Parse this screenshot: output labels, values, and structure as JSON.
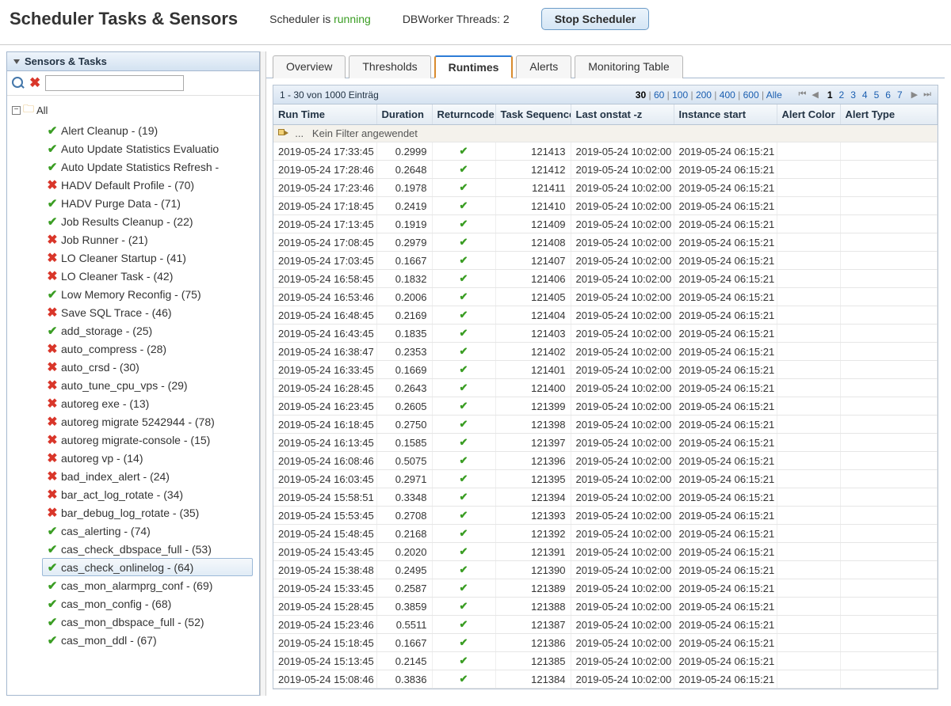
{
  "header": {
    "title": "Scheduler Tasks & Sensors",
    "scheduler_label": "Scheduler is ",
    "scheduler_status": "running",
    "dbworker": "DBWorker Threads: 2",
    "stop_button": "Stop Scheduler"
  },
  "sidebar": {
    "title": "Sensors & Tasks",
    "root_label": "All",
    "search_placeholder": "",
    "items": [
      {
        "status": "ok",
        "label": "Alert Cleanup - (19)"
      },
      {
        "status": "ok",
        "label": "Auto Update Statistics Evaluatio"
      },
      {
        "status": "ok",
        "label": "Auto Update Statistics Refresh -"
      },
      {
        "status": "err",
        "label": "HADV Default Profile - (70)"
      },
      {
        "status": "ok",
        "label": "HADV Purge Data - (71)"
      },
      {
        "status": "ok",
        "label": "Job Results Cleanup - (22)"
      },
      {
        "status": "err",
        "label": "Job Runner - (21)"
      },
      {
        "status": "err",
        "label": "LO Cleaner Startup - (41)"
      },
      {
        "status": "err",
        "label": "LO Cleaner Task - (42)"
      },
      {
        "status": "ok",
        "label": "Low Memory Reconfig - (75)"
      },
      {
        "status": "err",
        "label": "Save SQL Trace - (46)"
      },
      {
        "status": "ok",
        "label": "add_storage - (25)"
      },
      {
        "status": "err",
        "label": "auto_compress - (28)"
      },
      {
        "status": "err",
        "label": "auto_crsd - (30)"
      },
      {
        "status": "err",
        "label": "auto_tune_cpu_vps - (29)"
      },
      {
        "status": "err",
        "label": "autoreg exe - (13)"
      },
      {
        "status": "err",
        "label": "autoreg migrate 5242944 - (78)"
      },
      {
        "status": "err",
        "label": "autoreg migrate-console - (15)"
      },
      {
        "status": "err",
        "label": "autoreg vp - (14)"
      },
      {
        "status": "err",
        "label": "bad_index_alert - (24)"
      },
      {
        "status": "err",
        "label": "bar_act_log_rotate - (34)"
      },
      {
        "status": "err",
        "label": "bar_debug_log_rotate - (35)"
      },
      {
        "status": "ok",
        "label": "cas_alerting - (74)"
      },
      {
        "status": "ok",
        "label": "cas_check_dbspace_full - (53)"
      },
      {
        "status": "ok",
        "label": "cas_check_onlinelog - (64)",
        "selected": true
      },
      {
        "status": "ok",
        "label": "cas_mon_alarmprg_conf - (69)"
      },
      {
        "status": "ok",
        "label": "cas_mon_config - (68)"
      },
      {
        "status": "ok",
        "label": "cas_mon_dbspace_full - (52)"
      },
      {
        "status": "ok",
        "label": "cas_mon_ddl - (67)"
      }
    ]
  },
  "tabs": [
    {
      "label": "Overview"
    },
    {
      "label": "Thresholds"
    },
    {
      "label": "Runtimes",
      "active": true
    },
    {
      "label": "Alerts"
    },
    {
      "label": "Monitoring Table"
    }
  ],
  "grid": {
    "range": "1 - 30 von 1000 Einträg",
    "page_sizes": [
      "30",
      "60",
      "100",
      "200",
      "400",
      "600",
      "Alle"
    ],
    "current_page_size": "30",
    "pages": [
      "1",
      "2",
      "3",
      "4",
      "5",
      "6",
      "7"
    ],
    "current_page": "1",
    "filter_text": "Kein Filter angewendet",
    "filter_dots": "...",
    "columns": [
      "Run Time",
      "Duration",
      "Returncode",
      "Task Sequence",
      "Last onstat -z",
      "Instance start",
      "Alert Color",
      "Alert Type"
    ],
    "rows": [
      {
        "run": "2019-05-24 17:33:45",
        "dur": "0.2999",
        "seq": "121413",
        "onstat": "2019-05-24 10:02:00",
        "inst": "2019-05-24 06:15:21"
      },
      {
        "run": "2019-05-24 17:28:46",
        "dur": "0.2648",
        "seq": "121412",
        "onstat": "2019-05-24 10:02:00",
        "inst": "2019-05-24 06:15:21"
      },
      {
        "run": "2019-05-24 17:23:46",
        "dur": "0.1978",
        "seq": "121411",
        "onstat": "2019-05-24 10:02:00",
        "inst": "2019-05-24 06:15:21"
      },
      {
        "run": "2019-05-24 17:18:45",
        "dur": "0.2419",
        "seq": "121410",
        "onstat": "2019-05-24 10:02:00",
        "inst": "2019-05-24 06:15:21"
      },
      {
        "run": "2019-05-24 17:13:45",
        "dur": "0.1919",
        "seq": "121409",
        "onstat": "2019-05-24 10:02:00",
        "inst": "2019-05-24 06:15:21"
      },
      {
        "run": "2019-05-24 17:08:45",
        "dur": "0.2979",
        "seq": "121408",
        "onstat": "2019-05-24 10:02:00",
        "inst": "2019-05-24 06:15:21"
      },
      {
        "run": "2019-05-24 17:03:45",
        "dur": "0.1667",
        "seq": "121407",
        "onstat": "2019-05-24 10:02:00",
        "inst": "2019-05-24 06:15:21"
      },
      {
        "run": "2019-05-24 16:58:45",
        "dur": "0.1832",
        "seq": "121406",
        "onstat": "2019-05-24 10:02:00",
        "inst": "2019-05-24 06:15:21"
      },
      {
        "run": "2019-05-24 16:53:46",
        "dur": "0.2006",
        "seq": "121405",
        "onstat": "2019-05-24 10:02:00",
        "inst": "2019-05-24 06:15:21"
      },
      {
        "run": "2019-05-24 16:48:45",
        "dur": "0.2169",
        "seq": "121404",
        "onstat": "2019-05-24 10:02:00",
        "inst": "2019-05-24 06:15:21"
      },
      {
        "run": "2019-05-24 16:43:45",
        "dur": "0.1835",
        "seq": "121403",
        "onstat": "2019-05-24 10:02:00",
        "inst": "2019-05-24 06:15:21"
      },
      {
        "run": "2019-05-24 16:38:47",
        "dur": "0.2353",
        "seq": "121402",
        "onstat": "2019-05-24 10:02:00",
        "inst": "2019-05-24 06:15:21"
      },
      {
        "run": "2019-05-24 16:33:45",
        "dur": "0.1669",
        "seq": "121401",
        "onstat": "2019-05-24 10:02:00",
        "inst": "2019-05-24 06:15:21"
      },
      {
        "run": "2019-05-24 16:28:45",
        "dur": "0.2643",
        "seq": "121400",
        "onstat": "2019-05-24 10:02:00",
        "inst": "2019-05-24 06:15:21"
      },
      {
        "run": "2019-05-24 16:23:45",
        "dur": "0.2605",
        "seq": "121399",
        "onstat": "2019-05-24 10:02:00",
        "inst": "2019-05-24 06:15:21"
      },
      {
        "run": "2019-05-24 16:18:45",
        "dur": "0.2750",
        "seq": "121398",
        "onstat": "2019-05-24 10:02:00",
        "inst": "2019-05-24 06:15:21"
      },
      {
        "run": "2019-05-24 16:13:45",
        "dur": "0.1585",
        "seq": "121397",
        "onstat": "2019-05-24 10:02:00",
        "inst": "2019-05-24 06:15:21"
      },
      {
        "run": "2019-05-24 16:08:46",
        "dur": "0.5075",
        "seq": "121396",
        "onstat": "2019-05-24 10:02:00",
        "inst": "2019-05-24 06:15:21"
      },
      {
        "run": "2019-05-24 16:03:45",
        "dur": "0.2971",
        "seq": "121395",
        "onstat": "2019-05-24 10:02:00",
        "inst": "2019-05-24 06:15:21"
      },
      {
        "run": "2019-05-24 15:58:51",
        "dur": "0.3348",
        "seq": "121394",
        "onstat": "2019-05-24 10:02:00",
        "inst": "2019-05-24 06:15:21"
      },
      {
        "run": "2019-05-24 15:53:45",
        "dur": "0.2708",
        "seq": "121393",
        "onstat": "2019-05-24 10:02:00",
        "inst": "2019-05-24 06:15:21"
      },
      {
        "run": "2019-05-24 15:48:45",
        "dur": "0.2168",
        "seq": "121392",
        "onstat": "2019-05-24 10:02:00",
        "inst": "2019-05-24 06:15:21"
      },
      {
        "run": "2019-05-24 15:43:45",
        "dur": "0.2020",
        "seq": "121391",
        "onstat": "2019-05-24 10:02:00",
        "inst": "2019-05-24 06:15:21"
      },
      {
        "run": "2019-05-24 15:38:48",
        "dur": "0.2495",
        "seq": "121390",
        "onstat": "2019-05-24 10:02:00",
        "inst": "2019-05-24 06:15:21"
      },
      {
        "run": "2019-05-24 15:33:45",
        "dur": "0.2587",
        "seq": "121389",
        "onstat": "2019-05-24 10:02:00",
        "inst": "2019-05-24 06:15:21"
      },
      {
        "run": "2019-05-24 15:28:45",
        "dur": "0.3859",
        "seq": "121388",
        "onstat": "2019-05-24 10:02:00",
        "inst": "2019-05-24 06:15:21"
      },
      {
        "run": "2019-05-24 15:23:46",
        "dur": "0.5511",
        "seq": "121387",
        "onstat": "2019-05-24 10:02:00",
        "inst": "2019-05-24 06:15:21"
      },
      {
        "run": "2019-05-24 15:18:45",
        "dur": "0.1667",
        "seq": "121386",
        "onstat": "2019-05-24 10:02:00",
        "inst": "2019-05-24 06:15:21"
      },
      {
        "run": "2019-05-24 15:13:45",
        "dur": "0.2145",
        "seq": "121385",
        "onstat": "2019-05-24 10:02:00",
        "inst": "2019-05-24 06:15:21"
      },
      {
        "run": "2019-05-24 15:08:46",
        "dur": "0.3836",
        "seq": "121384",
        "onstat": "2019-05-24 10:02:00",
        "inst": "2019-05-24 06:15:21"
      }
    ]
  }
}
